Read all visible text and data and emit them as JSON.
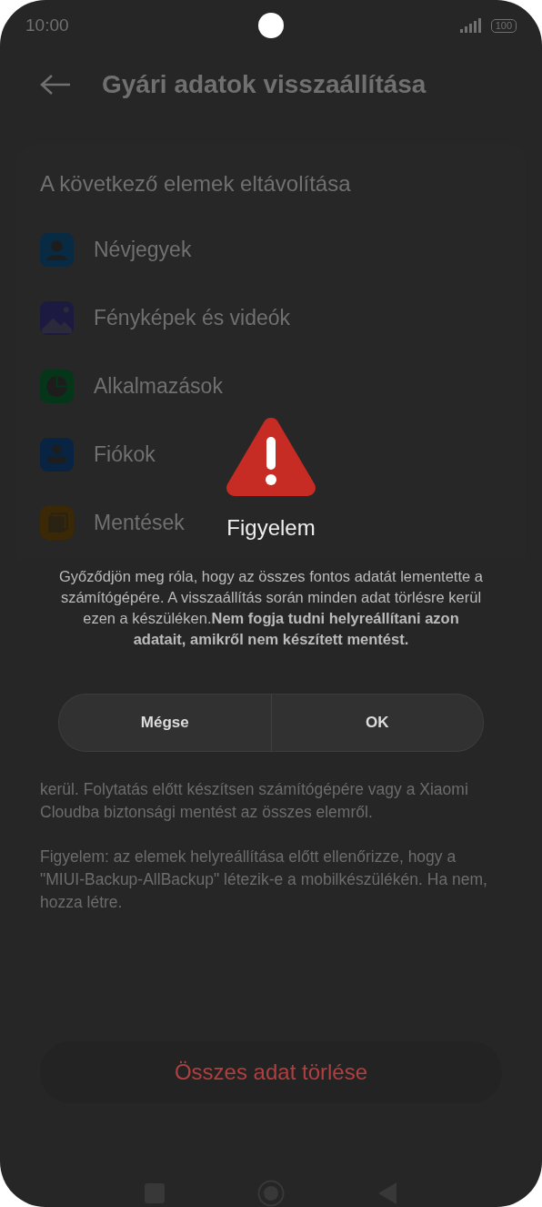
{
  "status_bar": {
    "time": "10:00",
    "battery": "100"
  },
  "header": {
    "title": "Gyári adatok visszaállítása"
  },
  "section": {
    "title": "A következő elemek eltávolítása",
    "items": [
      {
        "label": "Névjegyek",
        "kind": "contacts",
        "color": "#082a42"
      },
      {
        "label": "Fényképek és videók",
        "kind": "photos",
        "color": "#1c1a40"
      },
      {
        "label": "Alkalmazások",
        "kind": "apps",
        "color": "#06361a"
      },
      {
        "label": "Fiókok",
        "kind": "account",
        "color": "#082442"
      },
      {
        "label": "Mentések",
        "kind": "backup",
        "color": "#3a2806"
      }
    ]
  },
  "notes": [
    "kerül. Folytatás előtt készítsen számítógépére vagy a Xiaomi Cloudba biztonsági mentést az összes elemről.",
    "Figyelem: az elemek helyreállítása előtt ellenőrizze, hogy a \"MIUI-Backup-AllBackup\" létezik-e a mobilkészülékén. Ha nem, hozza létre."
  ],
  "erase_button": "Összes adat törlése",
  "dialog": {
    "title": "Figyelem",
    "message": "Győződjön meg róla, hogy az összes fontos adatát lementette a számítógépére. A visszaállítás során minden adat törlésre kerül ezen a készüléken.**Nem fogja tudni helyreállítani azon adatait, amikről nem készített mentést.**",
    "buttons": [
      "Mégse",
      "OK"
    ]
  }
}
